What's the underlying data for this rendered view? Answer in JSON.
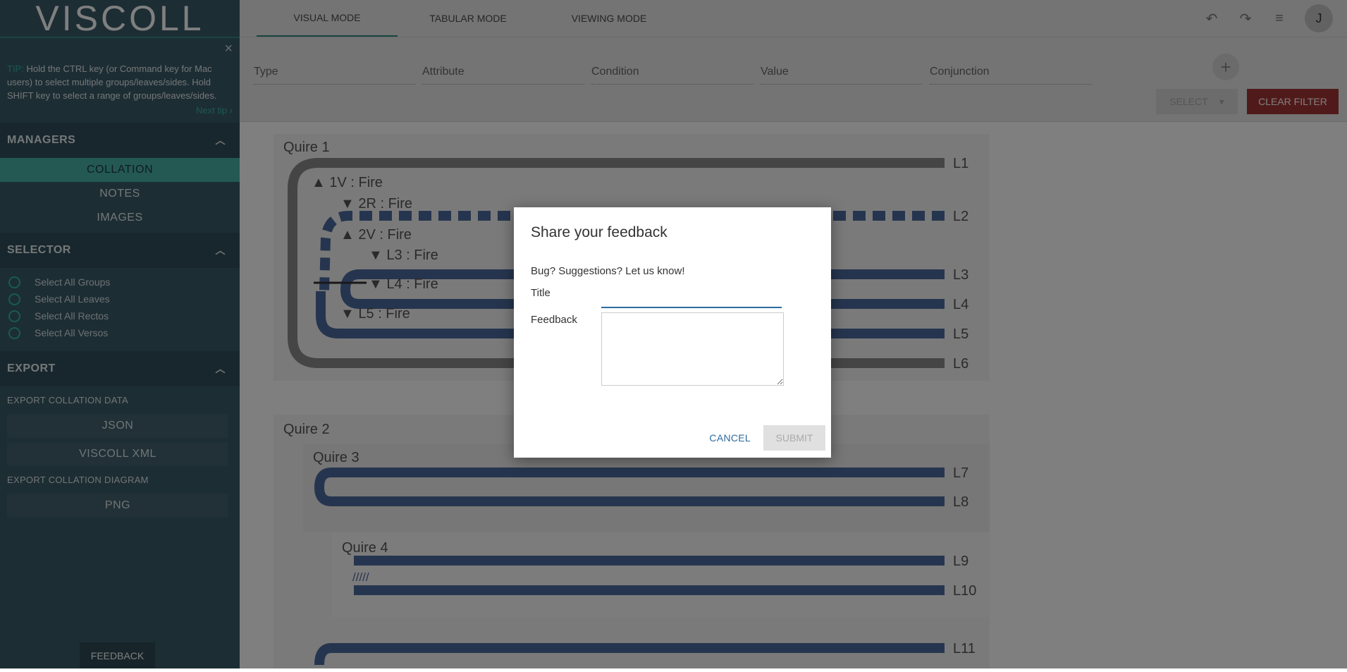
{
  "app": {
    "logo": "VISCOLL"
  },
  "tip": {
    "label": "TIP:",
    "text": "Hold the CTRL key (or Command key for Mac users) to select multiple groups/leaves/sides. Hold SHIFT key to select a range of groups/leaves/sides.",
    "next": "Next tip ›",
    "close": "×"
  },
  "sidebar": {
    "managers": {
      "title": "MANAGERS",
      "items": [
        "COLLATION",
        "NOTES",
        "IMAGES"
      ]
    },
    "selector": {
      "title": "SELECTOR",
      "options": [
        "Select All Groups",
        "Select All Leaves",
        "Select All Rectos",
        "Select All Versos"
      ]
    },
    "export": {
      "title": "EXPORT",
      "data_label": "EXPORT COLLATION DATA",
      "json": "JSON",
      "xml": "VISCOLL XML",
      "diagram_label": "EXPORT COLLATION DIAGRAM",
      "png": "PNG"
    },
    "feedback": "FEEDBACK"
  },
  "tabs": [
    "VISUAL MODE",
    "TABULAR MODE",
    "VIEWING MODE"
  ],
  "topbar": {
    "avatar": "J"
  },
  "filters": {
    "fields": [
      "Type",
      "Attribute",
      "Condition",
      "Value",
      "Conjunction"
    ],
    "select": "SELECT",
    "clear": "CLEAR FILTER"
  },
  "diagram": {
    "quires": [
      "Quire 1",
      "Quire 2",
      "Quire 3",
      "Quire 4"
    ],
    "sides": [
      "▲ 1V : Fire",
      "▼ 2R : Fire",
      "▲ 2V : Fire",
      "▼ L3 : Fire",
      "▼ L4 : Fire",
      "▼ L5 : Fire"
    ],
    "leaves": [
      "L1",
      "L2",
      "L3",
      "L4",
      "L5",
      "L6",
      "L7",
      "L8",
      "L9",
      "L10",
      "L11"
    ]
  },
  "modal": {
    "title": "Share your feedback",
    "desc": "Bug? Suggestions? Let us know!",
    "title_label": "Title",
    "feedback_label": "Feedback",
    "cancel": "CANCEL",
    "submit": "SUBMIT"
  },
  "colors": {
    "accent": "#2e8b84",
    "leaf": "#4c6a9f",
    "clear": "#a23434"
  }
}
